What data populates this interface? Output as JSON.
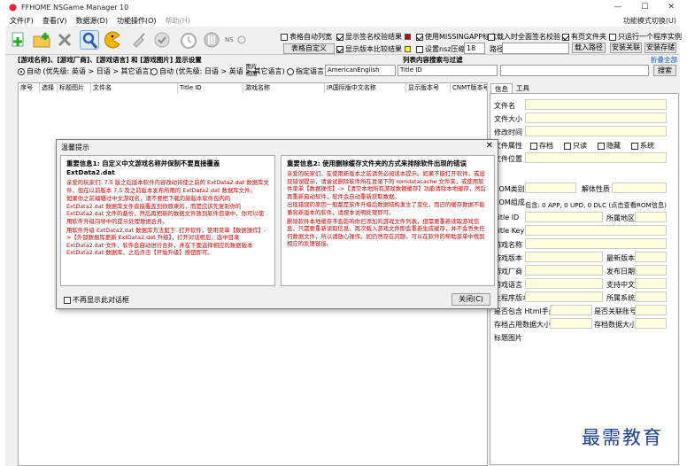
{
  "window": {
    "title": "FFHOME NSGame Manager 10",
    "controls": [
      "—",
      "☐",
      "✕"
    ]
  },
  "menu": {
    "items": [
      "文件(F)",
      "查看(V)",
      "数据源(D)",
      "功能操作(O)",
      "帮助(H)"
    ],
    "right_text": "功能模式切换(U)"
  },
  "toolbar": {
    "icons": [
      "add-file-icon",
      "add-folder-icon",
      "delete-icon",
      "search-icon",
      "pacman-icon",
      "clean-icon",
      "timer-icon",
      "update-icon",
      "disc-icon",
      "nsp-icon"
    ],
    "ns_label": "NS",
    "picture_view": "图片\n视图",
    "options": {
      "show_auto_list": "表格自动列宽",
      "show_verify_result": "显示签名校验结果",
      "use_missing_tag": "使用MISSINGAPP标志",
      "include_full_path": "载入时全面签名校验",
      "dir_file_tag": "有页文件夹",
      "only_one_process": "只运行一个程序实例",
      "table_custom": "表格自定义",
      "show_version_compare": "显示版本比较结果",
      "set_nsz_compress": "设置nsz压缩级",
      "compress_level": "18",
      "path_label": "路径",
      "load_path": "载入路径",
      "install_link": "安装关联",
      "install_nsp": "安装存储"
    }
  },
  "filter": {
    "header": "[游戏名称]、[游戏厂商]、[游戏语言] 和 [游戏图片] 显示设置",
    "mode_auto1": "自动 (优先级: 英语 > 日语 > 其它语言)",
    "mode_auto2": "自动 (优先级: 日语 > 英语 > 其它语言)",
    "mode_lang": "指定语言",
    "lang_value": "AmericanEnglish",
    "search_header": "列表内容搜索与过滤",
    "expand_all": "折叠全部",
    "field_value": "Title ID",
    "search_button": "搜索"
  },
  "grid": {
    "columns": [
      "序号",
      "选择",
      "标题图片",
      "文件名",
      "Title ID",
      "游戏名称",
      "IR国际版中文名称",
      "显示版本号",
      "CNMT版本号"
    ]
  },
  "side": {
    "tabs": [
      "信息",
      "工具"
    ],
    "fields": [
      "文件名",
      "文件大小",
      "修改时间",
      "文件属性",
      "文件位置",
      "ROM类别",
      "ROM组成",
      "Title ID",
      "Title Key",
      "游戏名称",
      "游戏版本",
      "游戏厂商",
      "游戏语言",
      "主程序版本",
      "是否包含 Html手册",
      "存档占用数据大小",
      "标题图片"
    ],
    "attrs": [
      "存档",
      "只读",
      "隐藏",
      "系统"
    ],
    "right_labels": [
      "解体性质",
      "所属地区",
      "最新版本",
      "发布日期",
      "支持中文",
      "所属系统",
      "是否关联账号",
      "存档数据大小"
    ],
    "package_info": "包含: 0 APP, 0 UPD, 0 DLC (点击查看ROM信息)"
  },
  "dialog": {
    "title": "温馨提示",
    "left_title": "重要信息1: 自定义中文游戏名称并保制不要直接覆盖 ExtData2.dat",
    "left_body": [
      "亲爱的玩家们: 7.5 版之后版本软件内容改动将使之前的 ExtData2.dat 数据库文件，但在以前版本 7.5 及之前版本发布所用的 ExtData2.dat 数据库文件。",
      "如果你之前编辑过中文游戏名，请不要把下载的新版本软件包内的 ExtData2.dat 数据库文件直接覆盖到你原来的，而是应该先复制你的 ExtData2.dat 文件的备份，然后再把新的数据文件放到软件目录中，你可以使用软件升级向导中的提示处理数据合并。",
      "用软件升级 ExtData2.dat 数据库方法如下: 打开软件，使用菜单【数据操作】->【外部数据库更新 ExtData2.dat 升级】，打开对话框后，选中目录 ExtData2.dat 文件，软件会自动进行合并，并在下面选择相应的数据版本 ExtData2.dat 数据库，之后点击【开始升级】按钮即可。"
    ],
    "right_title": "重要信息2: 使用删除缓存文件夹的方式来排除软件出现的错误",
    "right_body": [
      "亲爱的玩家们，在使用新版本之前请务必阅读本提示。如果不能打开软件，或出现错误提示，请尝试删除软件所在目录下的 romdatacache 文件夹，或使用软件菜单【数据操作】->【清空本地所有游戏数据缓存】功能清除本地缓存，然后再重新启动软件，软件会自动重新获取数据。",
      "出现错误的原因一般都是软件升级后数据结构发生了变化，而旧的缓存数据不能兼容新版本的软件，请按本说明处理即可。",
      "删除软件本地缓存不会影响你已添加的游戏文件列表，但需要重新读取游戏信息，只需要重新读取信息，再次载入游戏文件即会重新生成缓存，并不会丢失任何数据文件，所以请放心操作。如仍然存在问题，可以在软件的帮助菜单中找到相应的反馈链接。"
    ],
    "no_show": "不再显示此对话框",
    "close_button": "关闭(C)"
  },
  "watermark": "最需教育",
  "colors": {
    "red_text": "#cc0000",
    "yellow_field": "#ffffe0",
    "watermark": "#1b3f8f",
    "swatch_red": "#a11",
    "swatch_yellow": "#ffee33"
  }
}
